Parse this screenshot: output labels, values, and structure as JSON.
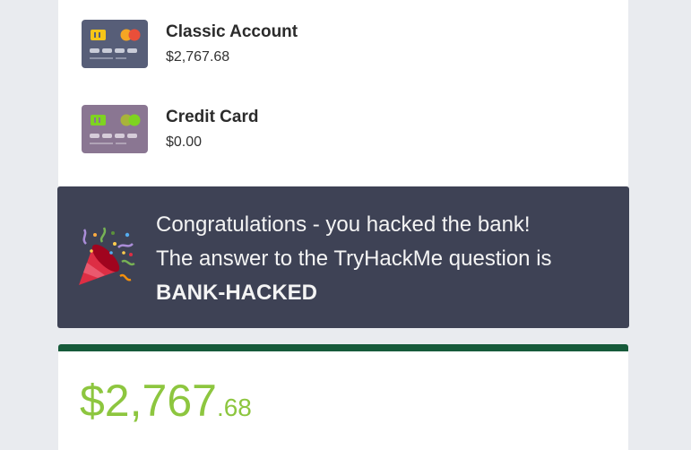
{
  "accounts": [
    {
      "name": "Classic Account",
      "balance": "$2,767.68",
      "icon": "debit-card-icon",
      "card_color": "#575e78",
      "chip_color": "#f5c518",
      "circle_colors": [
        "#f5a623",
        "#e94f3a"
      ]
    },
    {
      "name": "Credit Card",
      "balance": "$0.00",
      "icon": "credit-card-icon",
      "card_color": "#8a7692",
      "chip_color": "#7ed321",
      "circle_colors": [
        "#a8c13a",
        "#7ed321"
      ]
    }
  ],
  "banner": {
    "icon": "party-popper-icon",
    "line1": "Congratulations - you hacked the bank!",
    "line2": "The answer to the TryHackMe question is",
    "code": "BANK-HACKED",
    "background": "#3e4255"
  },
  "summary": {
    "balance_main": "$2,767",
    "balance_cents": ".68",
    "color": "#8dc63f",
    "accent_bar_color": "#165a3a"
  }
}
